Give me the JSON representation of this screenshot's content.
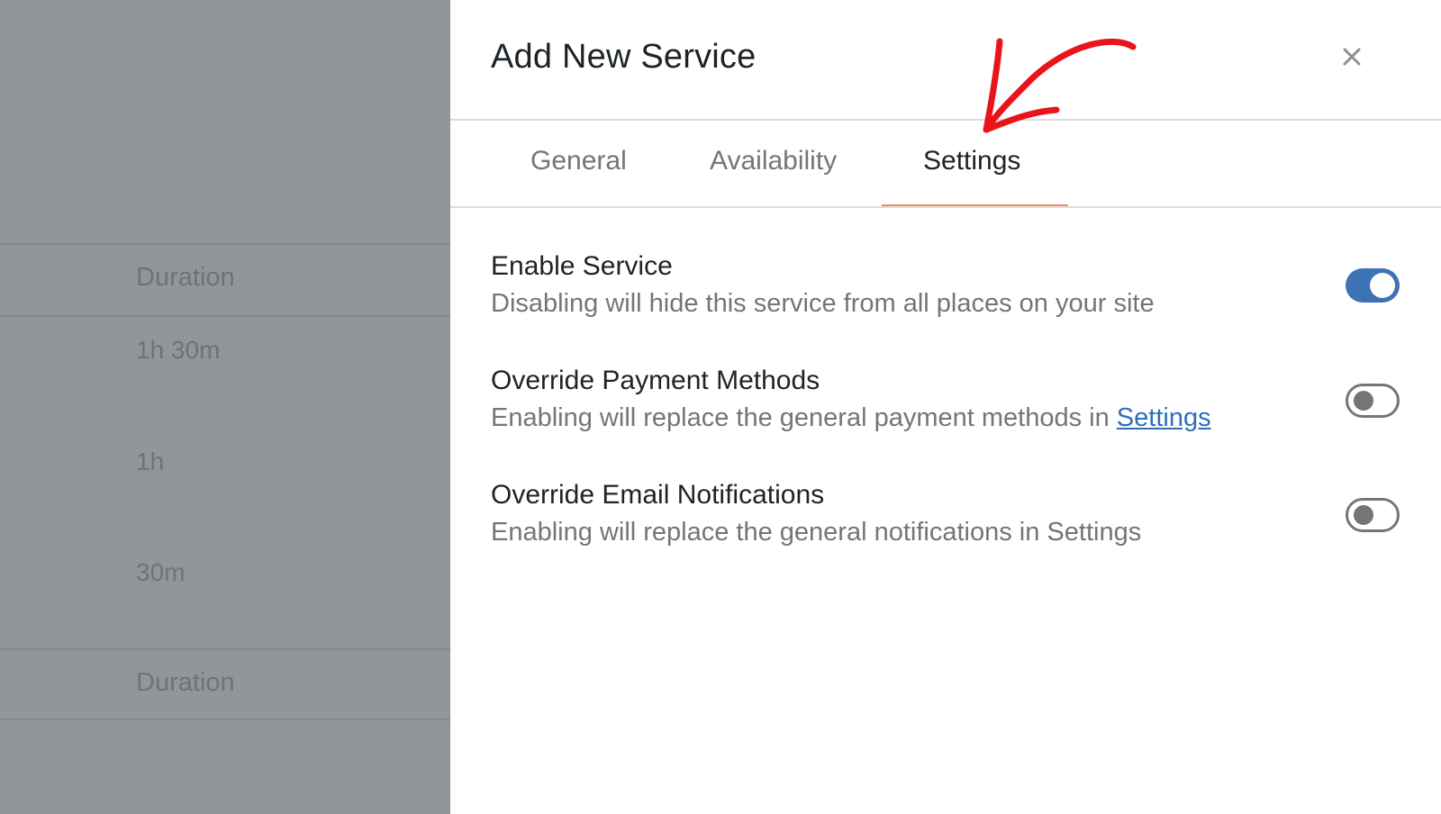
{
  "background": {
    "header_label": "Duration",
    "rows": [
      "1h 30m",
      "1h",
      "30m"
    ],
    "footer_label": "Duration"
  },
  "drawer": {
    "title": "Add New Service",
    "close_icon": "close-icon",
    "tabs": [
      {
        "label": "General",
        "active": false
      },
      {
        "label": "Availability",
        "active": false
      },
      {
        "label": "Settings",
        "active": true
      }
    ],
    "settings": [
      {
        "title": "Enable Service",
        "description": "Disabling will hide this service from all places on your site",
        "enabled": true
      },
      {
        "title": "Override Payment Methods",
        "description": "Enabling will replace the general payment methods in ",
        "link_text": "Settings",
        "enabled": false
      },
      {
        "title": "Override Email Notifications",
        "description": "Enabling will replace the general notifications in Settings",
        "enabled": false
      }
    ]
  },
  "colors": {
    "accent": "#3d72b4",
    "tab_underline": "#f0905a",
    "annotation_arrow": "#e8141b",
    "backdrop": "#929599"
  }
}
